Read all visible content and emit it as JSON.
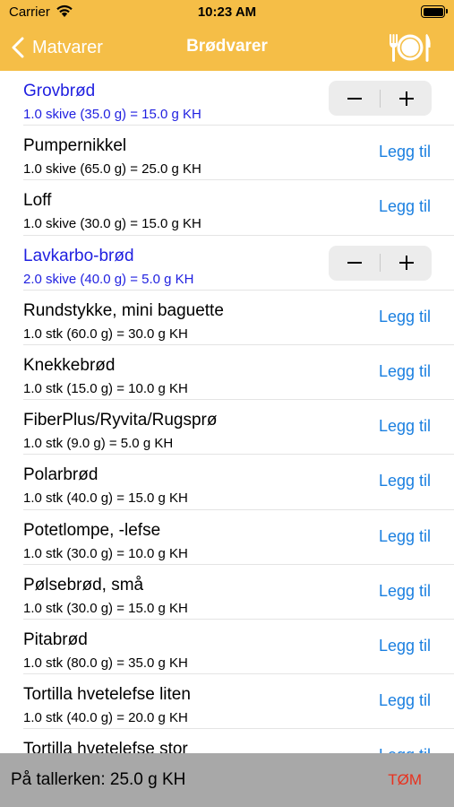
{
  "status_bar": {
    "carrier": "Carrier",
    "time": "10:23 AM"
  },
  "nav": {
    "back_label": "Matvarer",
    "title": "Brødvarer"
  },
  "list": {
    "add_label": "Legg til",
    "items": [
      {
        "name": "Grovbrød",
        "detail": "1.0 skive (35.0 g) = 15.0 g KH",
        "selected": true
      },
      {
        "name": "Pumpernikkel",
        "detail": "1.0 skive (65.0 g) = 25.0 g KH",
        "selected": false
      },
      {
        "name": "Loff",
        "detail": "1.0 skive (30.0 g) = 15.0 g KH",
        "selected": false
      },
      {
        "name": "Lavkarbo-brød",
        "detail": "2.0 skive (40.0 g) = 5.0 g KH",
        "selected": true
      },
      {
        "name": "Rundstykke, mini baguette",
        "detail": "1.0 stk (60.0 g) = 30.0 g KH",
        "selected": false
      },
      {
        "name": "Knekkebrød",
        "detail": "1.0 stk (15.0 g) = 10.0 g KH",
        "selected": false
      },
      {
        "name": "FiberPlus/Ryvita/Rugsprø",
        "detail": "1.0 stk (9.0 g) = 5.0 g KH",
        "selected": false
      },
      {
        "name": "Polarbrød",
        "detail": "1.0 stk (40.0 g) = 15.0 g KH",
        "selected": false
      },
      {
        "name": "Potetlompe, -lefse",
        "detail": "1.0 stk (30.0 g) = 10.0 g KH",
        "selected": false
      },
      {
        "name": "Pølsebrød, små",
        "detail": "1.0 stk (30.0 g) = 15.0 g KH",
        "selected": false
      },
      {
        "name": "Pitabrød",
        "detail": "1.0 stk (80.0 g) = 35.0 g KH",
        "selected": false
      },
      {
        "name": "Tortilla hvetelefse liten",
        "detail": "1.0 stk (40.0 g) = 20.0 g KH",
        "selected": false
      },
      {
        "name": "Tortilla hvetelefse stor",
        "detail": "",
        "selected": false
      }
    ]
  },
  "bottom_bar": {
    "total_text": "På tallerken: 25.0 g KH",
    "clear_label": "TØM"
  },
  "colors": {
    "nav_background": "#F5BE47",
    "selected_text": "#1f1fe0",
    "action_blue": "#1a7fe0",
    "clear_red": "#e8321f",
    "bottom_background": "#a8a8a8"
  },
  "icons": {
    "back": "chevron-left-icon",
    "plate": "plate-fork-knife-icon",
    "wifi": "wifi-icon",
    "battery": "battery-icon",
    "minus": "minus-icon",
    "plus": "plus-icon"
  }
}
